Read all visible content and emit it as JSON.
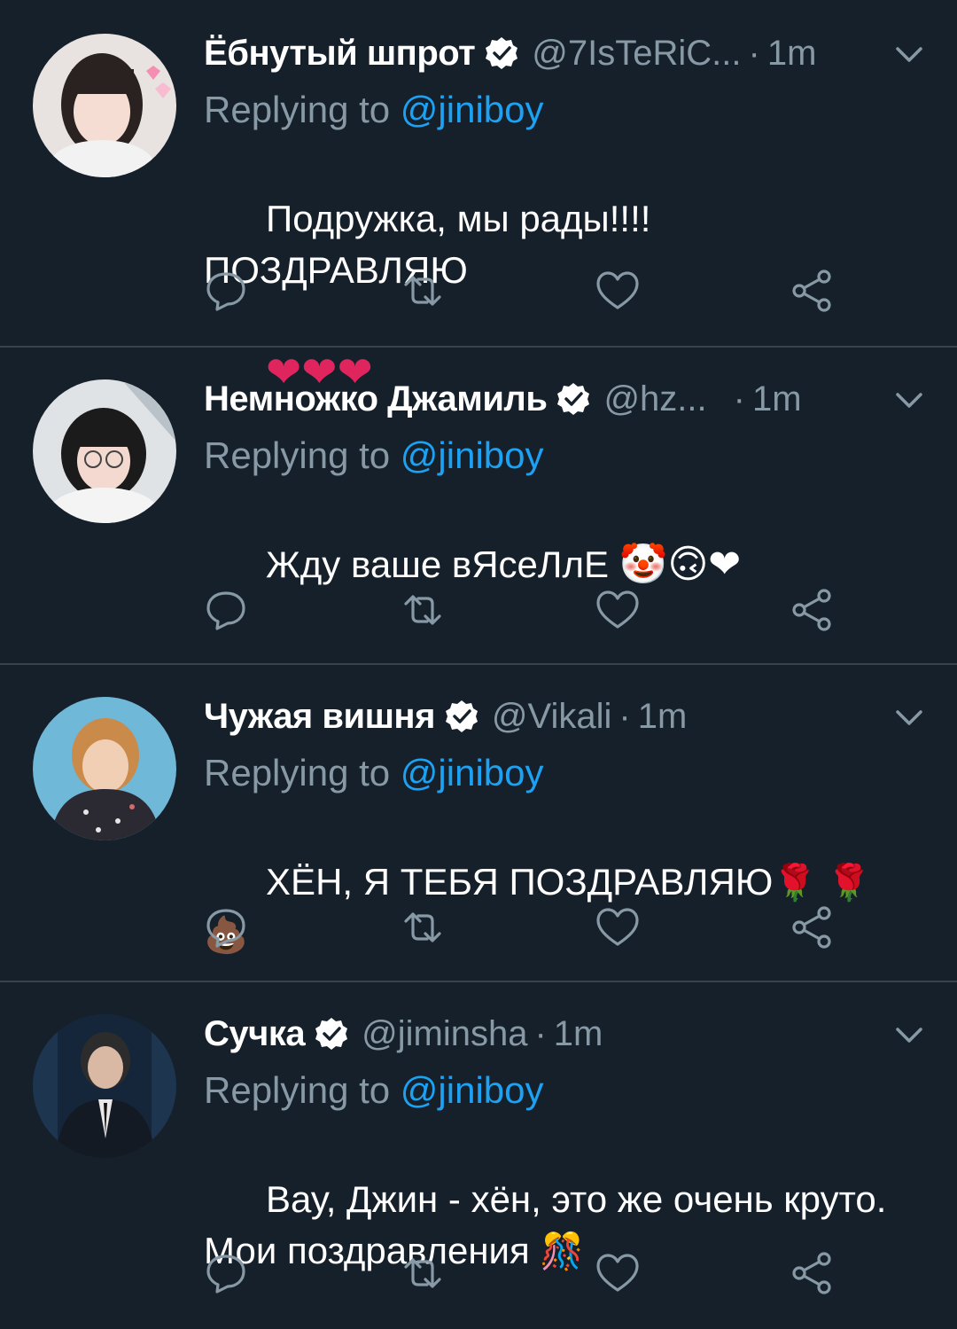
{
  "colors": {
    "background": "#15202b",
    "divider": "#38444d",
    "secondary_text": "#8899a6",
    "mention": "#1da1f2",
    "verified_badge": "#ffffff"
  },
  "tweets": [
    {
      "name": "Ёбнутый шпрот",
      "handle": "@7IsTeRiC...",
      "dot": "·",
      "time": "1m",
      "reply_prefix": "Replying to ",
      "reply_to": "@jiniboy",
      "text": "Подружка, мы рады!!!! ПОЗДРАВЛЯЮ",
      "emojis": "❤❤❤",
      "avatar_icon": "avatar-girl-hearts",
      "icons": [
        "verified-badge-icon",
        "chevron-down-icon",
        "reply-icon",
        "retweet-icon",
        "like-icon",
        "share-icon"
      ]
    },
    {
      "name": "Немножко Джамиль",
      "handle": "@hz...",
      "dot": "·",
      "time": "1m",
      "reply_prefix": "Replying to ",
      "reply_to": "@jiniboy",
      "text": "Жду ваше вЯсеЛлЕ ",
      "emojis": "🤡🙃❤",
      "avatar_icon": "avatar-girl-glasses"
    },
    {
      "name": "Чужая вишня",
      "handle": "@Vikali",
      "dot": "·",
      "time": "1m",
      "reply_prefix": "Replying to ",
      "reply_to": "@jiniboy",
      "text": "ХЁН, Я ТЕБЯ ПОЗДРАВЛЯЮ",
      "emojis": "🌹 🌹 💩",
      "avatar_icon": "avatar-boy-blue-bg"
    },
    {
      "name": "Сучка",
      "handle": "@jiminsha",
      "dot": "·",
      "time": "1m",
      "reply_prefix": "Replying to ",
      "reply_to": "@jiniboy",
      "text": "Вау, Джин - хён, это же очень круто.\nМои поздравления ",
      "emojis": "🎊",
      "avatar_icon": "avatar-man-suit"
    }
  ]
}
